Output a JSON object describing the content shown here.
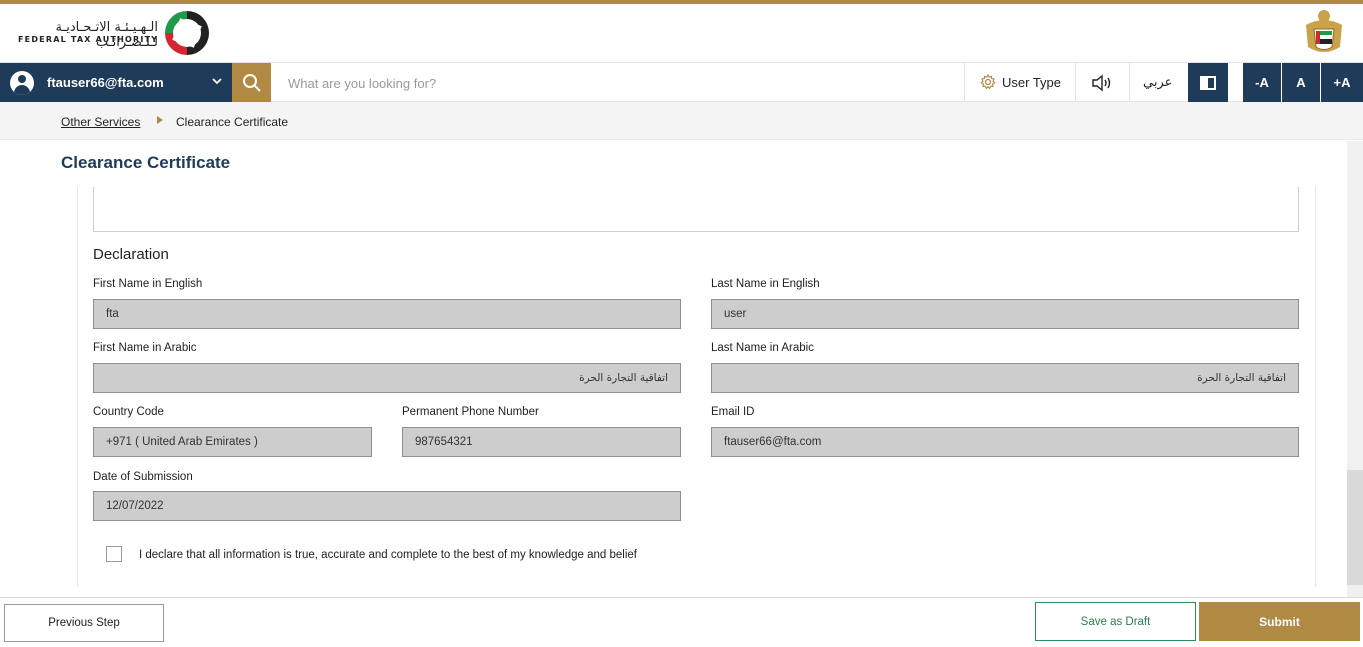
{
  "header": {
    "logo_arabic": "الـهـيـئـة الاتـحـاديـة لـلـضـرائـب",
    "logo_english": "FEDERAL TAX AUTHORITY",
    "brand_color": "#b08a43",
    "primary_color": "#1e3c5a"
  },
  "navbar": {
    "user_email": "ftauser66@fta.com",
    "search_placeholder": "What are you looking for?",
    "user_type_label": "User Type",
    "arabic_label": "عربي",
    "font_decrease": "-A",
    "font_normal": "A",
    "font_increase": "+A"
  },
  "breadcrumb": {
    "parent": "Other Services",
    "current": "Clearance Certificate"
  },
  "page": {
    "title": "Clearance Certificate"
  },
  "declaration": {
    "title": "Declaration",
    "first_name_en_label": "First Name in English",
    "first_name_en_value": "fta",
    "last_name_en_label": "Last Name in English",
    "last_name_en_value": "user",
    "first_name_ar_label": "First Name in Arabic",
    "first_name_ar_value": "اتفاقية التجارة الحرة",
    "last_name_ar_label": "Last Name in Arabic",
    "last_name_ar_value": "اتفاقية التجارة الحرة",
    "country_code_label": "Country Code",
    "country_code_value": "+971 ( United Arab Emirates )",
    "phone_label": "Permanent Phone Number",
    "phone_value": "987654321",
    "email_label": "Email ID",
    "email_value": "ftauser66@fta.com",
    "date_label": "Date of Submission",
    "date_value": "12/07/2022",
    "checkbox_text": "I declare that all information is true, accurate and complete to the best of my knowledge and belief"
  },
  "footer": {
    "previous_label": "Previous Step",
    "draft_label": "Save as Draft",
    "submit_label": "Submit"
  }
}
